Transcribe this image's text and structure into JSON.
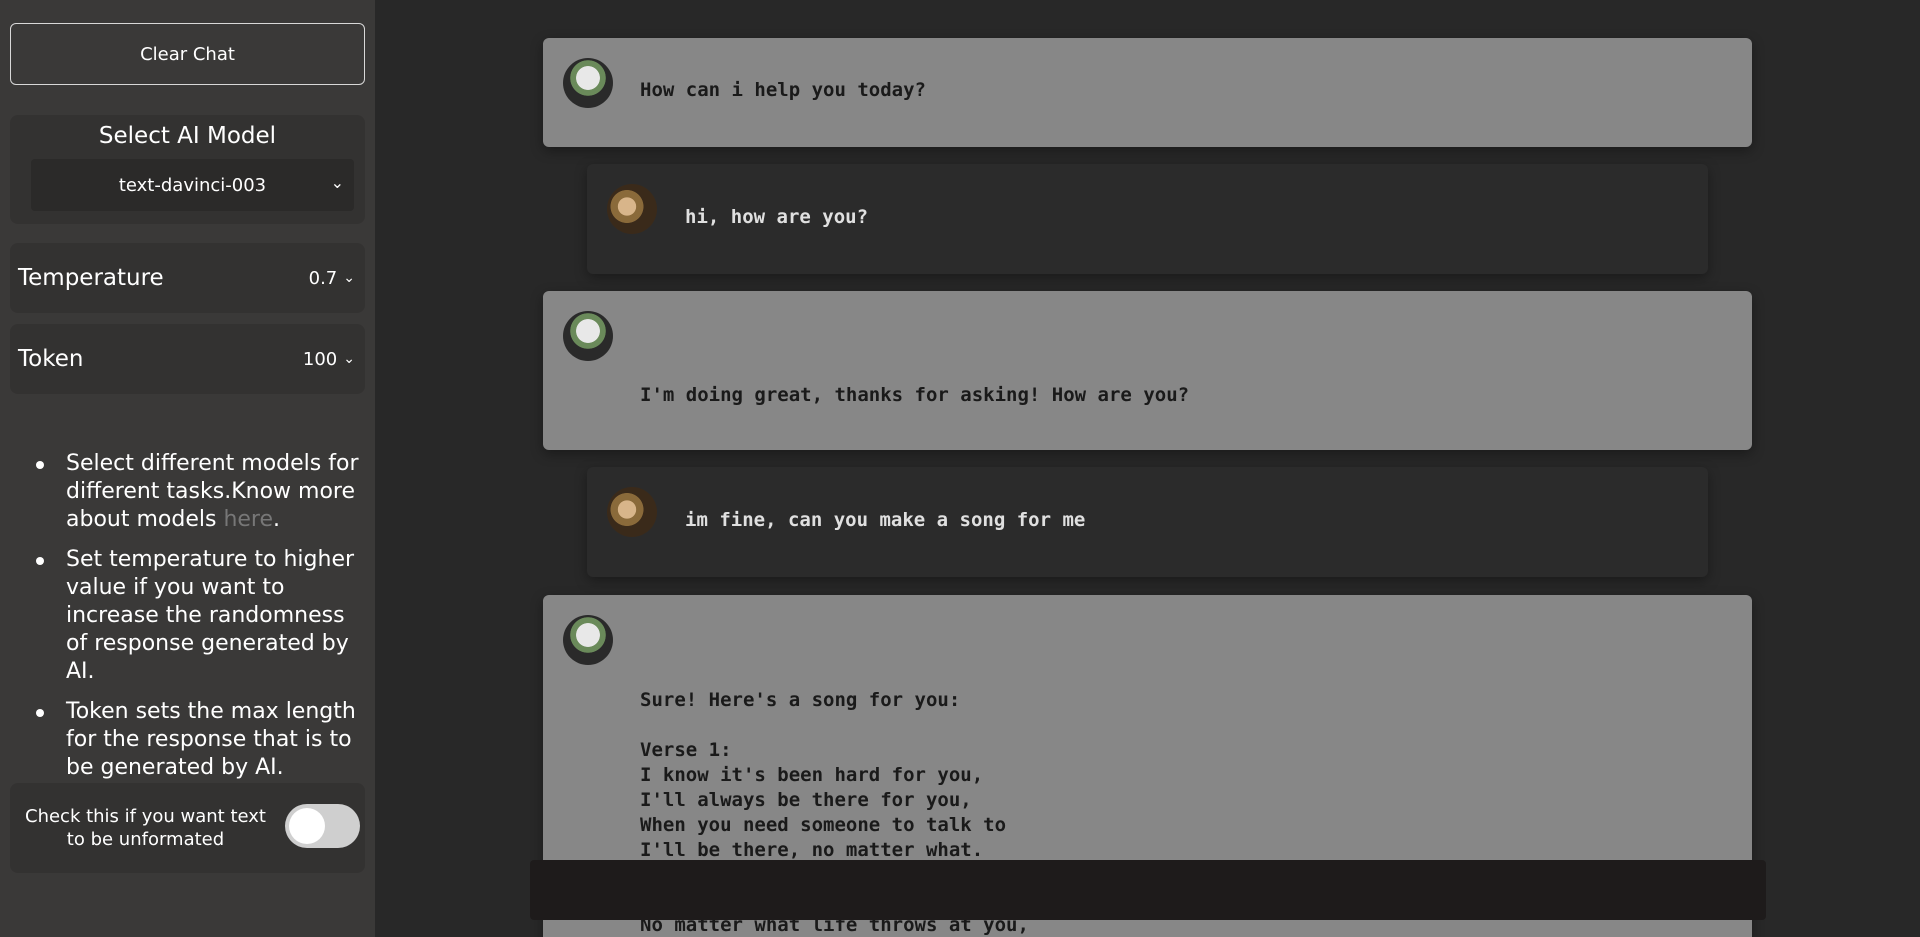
{
  "sidebar": {
    "clear_chat": "Clear Chat",
    "model_title": "Select AI Model",
    "model_value": "text-davinci-003",
    "temperature_label": "Temperature",
    "temperature_value": "0.7",
    "token_label": "Token",
    "token_value": "100",
    "tips": {
      "t1_pre": "Select different models for different tasks.Know more about models ",
      "t1_link": "here",
      "t1_post": ".",
      "t2": "Set temperature to higher value if you want to increase the randomness of response generated by AI.",
      "t3": "Token sets the max length for the response that is to be generated by AI."
    },
    "unformatted_label": "Check this if you want text to be unformated",
    "unformatted_checked": false
  },
  "chat": {
    "m1": "How can i help you today?",
    "m2": "hi, how are you?",
    "m3": "I'm doing great, thanks for asking! How are you?",
    "m4": "im fine, can you make a song for me",
    "m5": "Sure! Here's a song for you:\n\nVerse 1:\nI know it's been hard for you,\nI'll always be there for you,\nWhen you need someone to talk to\nI'll be there, no matter what.\n\n\nNo matter what life throws at you,"
  },
  "colors": {
    "sidebar_bg": "#3a3938",
    "chat_bg": "#282828",
    "ai_bubble": "#878787",
    "user_bubble": "#2b2b2b"
  }
}
